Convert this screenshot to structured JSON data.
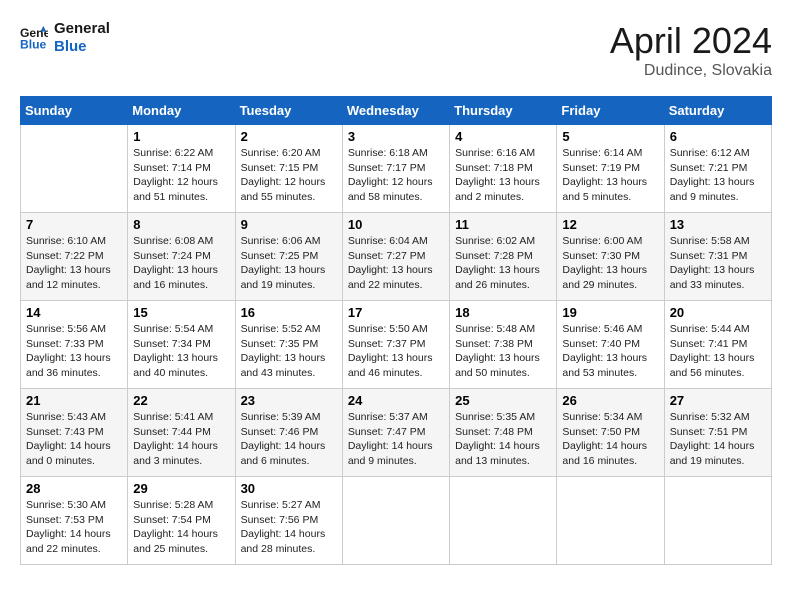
{
  "header": {
    "logo_line1": "General",
    "logo_line2": "Blue",
    "title": "April 2024",
    "location": "Dudince, Slovakia"
  },
  "weekdays": [
    "Sunday",
    "Monday",
    "Tuesday",
    "Wednesday",
    "Thursday",
    "Friday",
    "Saturday"
  ],
  "weeks": [
    [
      {
        "day": "",
        "info": ""
      },
      {
        "day": "1",
        "info": "Sunrise: 6:22 AM\nSunset: 7:14 PM\nDaylight: 12 hours\nand 51 minutes."
      },
      {
        "day": "2",
        "info": "Sunrise: 6:20 AM\nSunset: 7:15 PM\nDaylight: 12 hours\nand 55 minutes."
      },
      {
        "day": "3",
        "info": "Sunrise: 6:18 AM\nSunset: 7:17 PM\nDaylight: 12 hours\nand 58 minutes."
      },
      {
        "day": "4",
        "info": "Sunrise: 6:16 AM\nSunset: 7:18 PM\nDaylight: 13 hours\nand 2 minutes."
      },
      {
        "day": "5",
        "info": "Sunrise: 6:14 AM\nSunset: 7:19 PM\nDaylight: 13 hours\nand 5 minutes."
      },
      {
        "day": "6",
        "info": "Sunrise: 6:12 AM\nSunset: 7:21 PM\nDaylight: 13 hours\nand 9 minutes."
      }
    ],
    [
      {
        "day": "7",
        "info": "Sunrise: 6:10 AM\nSunset: 7:22 PM\nDaylight: 13 hours\nand 12 minutes."
      },
      {
        "day": "8",
        "info": "Sunrise: 6:08 AM\nSunset: 7:24 PM\nDaylight: 13 hours\nand 16 minutes."
      },
      {
        "day": "9",
        "info": "Sunrise: 6:06 AM\nSunset: 7:25 PM\nDaylight: 13 hours\nand 19 minutes."
      },
      {
        "day": "10",
        "info": "Sunrise: 6:04 AM\nSunset: 7:27 PM\nDaylight: 13 hours\nand 22 minutes."
      },
      {
        "day": "11",
        "info": "Sunrise: 6:02 AM\nSunset: 7:28 PM\nDaylight: 13 hours\nand 26 minutes."
      },
      {
        "day": "12",
        "info": "Sunrise: 6:00 AM\nSunset: 7:30 PM\nDaylight: 13 hours\nand 29 minutes."
      },
      {
        "day": "13",
        "info": "Sunrise: 5:58 AM\nSunset: 7:31 PM\nDaylight: 13 hours\nand 33 minutes."
      }
    ],
    [
      {
        "day": "14",
        "info": "Sunrise: 5:56 AM\nSunset: 7:33 PM\nDaylight: 13 hours\nand 36 minutes."
      },
      {
        "day": "15",
        "info": "Sunrise: 5:54 AM\nSunset: 7:34 PM\nDaylight: 13 hours\nand 40 minutes."
      },
      {
        "day": "16",
        "info": "Sunrise: 5:52 AM\nSunset: 7:35 PM\nDaylight: 13 hours\nand 43 minutes."
      },
      {
        "day": "17",
        "info": "Sunrise: 5:50 AM\nSunset: 7:37 PM\nDaylight: 13 hours\nand 46 minutes."
      },
      {
        "day": "18",
        "info": "Sunrise: 5:48 AM\nSunset: 7:38 PM\nDaylight: 13 hours\nand 50 minutes."
      },
      {
        "day": "19",
        "info": "Sunrise: 5:46 AM\nSunset: 7:40 PM\nDaylight: 13 hours\nand 53 minutes."
      },
      {
        "day": "20",
        "info": "Sunrise: 5:44 AM\nSunset: 7:41 PM\nDaylight: 13 hours\nand 56 minutes."
      }
    ],
    [
      {
        "day": "21",
        "info": "Sunrise: 5:43 AM\nSunset: 7:43 PM\nDaylight: 14 hours\nand 0 minutes."
      },
      {
        "day": "22",
        "info": "Sunrise: 5:41 AM\nSunset: 7:44 PM\nDaylight: 14 hours\nand 3 minutes."
      },
      {
        "day": "23",
        "info": "Sunrise: 5:39 AM\nSunset: 7:46 PM\nDaylight: 14 hours\nand 6 minutes."
      },
      {
        "day": "24",
        "info": "Sunrise: 5:37 AM\nSunset: 7:47 PM\nDaylight: 14 hours\nand 9 minutes."
      },
      {
        "day": "25",
        "info": "Sunrise: 5:35 AM\nSunset: 7:48 PM\nDaylight: 14 hours\nand 13 minutes."
      },
      {
        "day": "26",
        "info": "Sunrise: 5:34 AM\nSunset: 7:50 PM\nDaylight: 14 hours\nand 16 minutes."
      },
      {
        "day": "27",
        "info": "Sunrise: 5:32 AM\nSunset: 7:51 PM\nDaylight: 14 hours\nand 19 minutes."
      }
    ],
    [
      {
        "day": "28",
        "info": "Sunrise: 5:30 AM\nSunset: 7:53 PM\nDaylight: 14 hours\nand 22 minutes."
      },
      {
        "day": "29",
        "info": "Sunrise: 5:28 AM\nSunset: 7:54 PM\nDaylight: 14 hours\nand 25 minutes."
      },
      {
        "day": "30",
        "info": "Sunrise: 5:27 AM\nSunset: 7:56 PM\nDaylight: 14 hours\nand 28 minutes."
      },
      {
        "day": "",
        "info": ""
      },
      {
        "day": "",
        "info": ""
      },
      {
        "day": "",
        "info": ""
      },
      {
        "day": "",
        "info": ""
      }
    ]
  ]
}
